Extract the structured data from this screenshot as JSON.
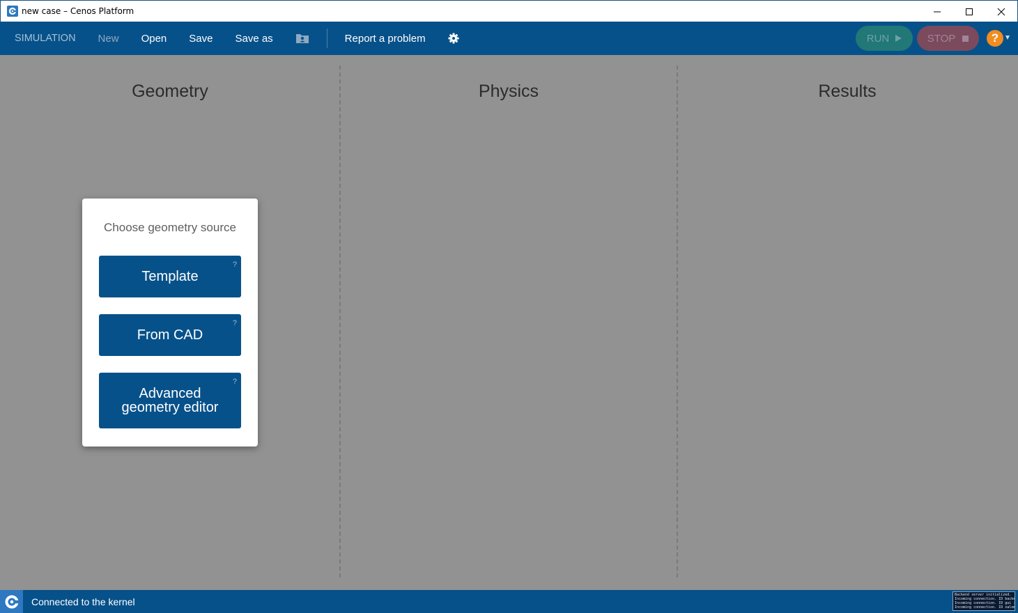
{
  "window": {
    "title": "new case – Cenos Platform",
    "controls": [
      "minimize",
      "maximize",
      "close"
    ]
  },
  "toolbar": {
    "section_label": "SIMULATION",
    "new_label": "New",
    "open_label": "Open",
    "save_label": "Save",
    "save_as_label": "Save as",
    "folder_icon": "folder-user-icon",
    "report_label": "Report a problem",
    "settings_icon": "gear-icon",
    "run_label": "RUN",
    "stop_label": "STOP",
    "help_label": "?"
  },
  "columns": [
    {
      "title": "Geometry"
    },
    {
      "title": "Physics"
    },
    {
      "title": "Results"
    }
  ],
  "geometry_card": {
    "title": "Choose geometry source",
    "options": [
      {
        "label": "Template",
        "help": "?"
      },
      {
        "label": "From CAD",
        "help": "?"
      },
      {
        "label_line1": "Advanced",
        "label_line2": "geometry editor",
        "help": "?"
      }
    ]
  },
  "statusbar": {
    "text": "Connected to the kernel",
    "console_lines": [
      "Backend server initialized.",
      "Incoming connection. ID backe",
      "Incoming connection. ID gui :",
      "Incoming connection. ID salom"
    ]
  },
  "colors": {
    "brand_blue": "#07518a",
    "run_green": "#217876",
    "stop_red": "#7b4a5d",
    "help_orange": "#f28c1f"
  }
}
